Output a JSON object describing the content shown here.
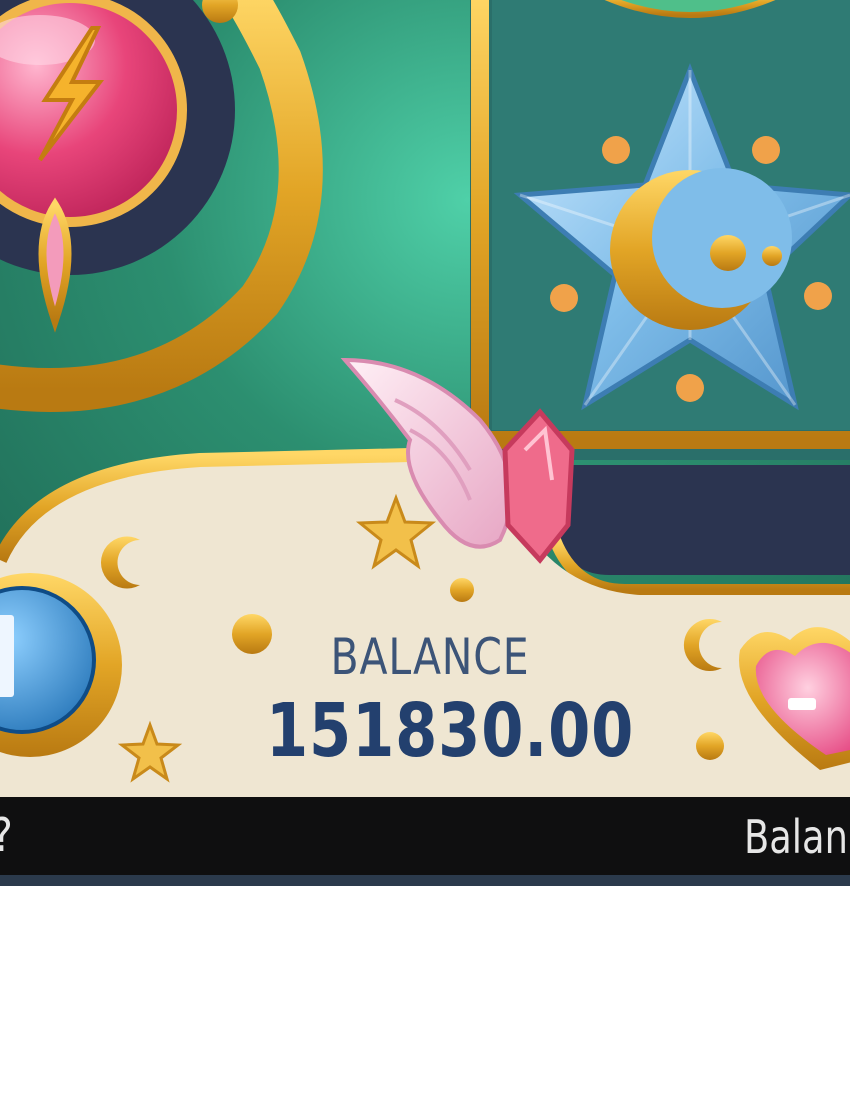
{
  "balance_panel": {
    "label": "BALANCE",
    "value": "151830.00"
  },
  "bottom_bar": {
    "left_text": "?",
    "right_text": "Balan"
  },
  "colors": {
    "background_green": "#2f8a6c",
    "panel_cream": "#efe6d2",
    "gold": "#e2a526",
    "navy": "#2b3450",
    "balance_text": "#23406e"
  },
  "symbols": [
    {
      "name": "pink-lightning-gem",
      "icon": "lightning-icon"
    },
    {
      "name": "blue-star-moon",
      "icon": "star-moon-icon"
    }
  ],
  "buttons": [
    {
      "name": "info-button",
      "icon": "info-icon"
    },
    {
      "name": "heart-button",
      "icon": "heart-icon"
    }
  ]
}
